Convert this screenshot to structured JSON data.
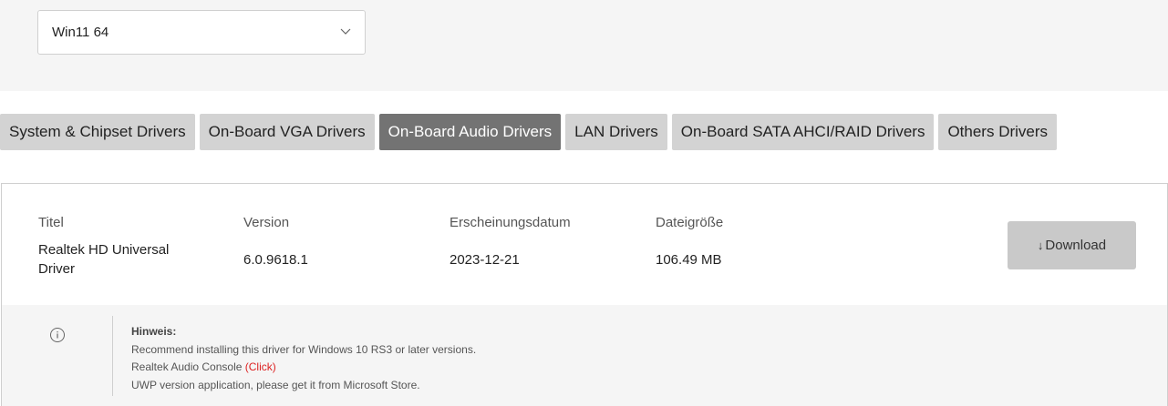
{
  "os_select": {
    "value": "Win11 64"
  },
  "tabs": [
    {
      "label": "System & Chipset Drivers",
      "active": false
    },
    {
      "label": "On-Board VGA Drivers",
      "active": false
    },
    {
      "label": "On-Board Audio Drivers",
      "active": true
    },
    {
      "label": "LAN Drivers",
      "active": false
    },
    {
      "label": "On-Board SATA AHCI/RAID Drivers",
      "active": false
    },
    {
      "label": "Others Drivers",
      "active": false
    }
  ],
  "driver": {
    "headers": {
      "title": "Titel",
      "version": "Version",
      "date": "Erscheinungsdatum",
      "size": "Dateigröße"
    },
    "title_line1": "Realtek HD Universal",
    "title_line2": "Driver",
    "version": "6.0.9618.1",
    "date": "2023-12-21",
    "size": "106.49 MB",
    "download_label": "Download",
    "download_icon": "download-arrow-icon"
  },
  "note": {
    "heading": "Hinweis:",
    "line1": "Recommend installing this driver for Windows 10 RS3 or later versions.",
    "line2_text": "Realtek Audio Console",
    "line2_link": "(Click)",
    "line3": "UWP version application, please get it from Microsoft Store."
  },
  "colors": {
    "tab_active": "#737373",
    "tab": "#d3d3d3",
    "link": "#dd2222"
  }
}
